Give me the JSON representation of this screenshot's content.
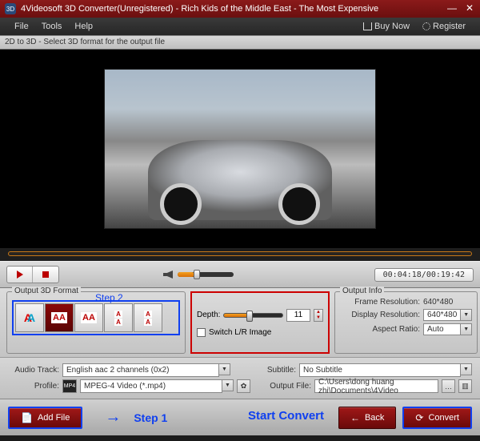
{
  "titlebar": {
    "title": "4Videosoft 3D Converter(Unregistered) - Rich Kids of the Middle East - The Most Expensive"
  },
  "menu": {
    "file": "File",
    "tools": "Tools",
    "help": "Help",
    "buy": "Buy Now",
    "register": "Register"
  },
  "subbar": {
    "text": "2D to 3D - Select 3D format for the output file"
  },
  "controls": {
    "time": "00:04:18/00:19:42"
  },
  "format": {
    "legend": "Output 3D Format",
    "step2": "Step 2"
  },
  "depth": {
    "label": "Depth:",
    "value": "11",
    "switch": "Switch L/R Image"
  },
  "info": {
    "legend": "Output Info",
    "frame_lbl": "Frame Resolution:",
    "frame_val": "640*480",
    "disp_lbl": "Display Resolution:",
    "disp_val": "640*480",
    "aspect_lbl": "Aspect Ratio:",
    "aspect_val": "Auto"
  },
  "low": {
    "audio_lbl": "Audio Track:",
    "audio_val": "English aac 2 channels (0x2)",
    "subtitle_lbl": "Subtitle:",
    "subtitle_val": "No Subtitle",
    "profile_lbl": "Profile:",
    "profile_val": "MPEG-4 Video (*.mp4)",
    "output_lbl": "Output File:",
    "output_val": "C:\\Users\\dong huang zhi\\Documents\\4Video"
  },
  "bottom": {
    "add": "Add File",
    "back": "Back",
    "convert": "Convert",
    "step1": "Step 1",
    "start": "Start Convert"
  }
}
